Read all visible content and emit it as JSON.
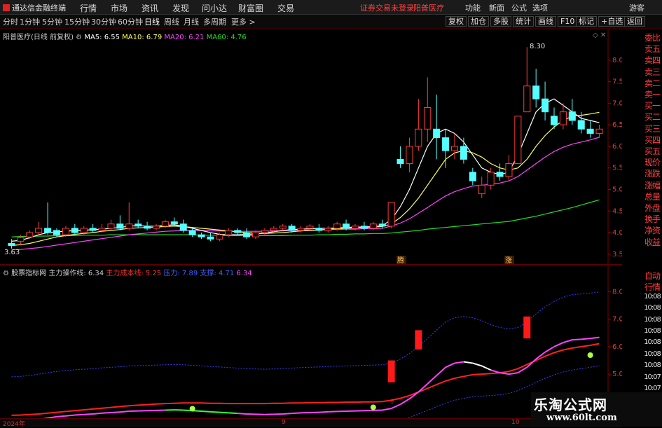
{
  "menu": {
    "app_title": "通达信金融终端",
    "items": [
      "行情",
      "市场",
      "资讯",
      "发现",
      "问小达",
      "财富圈",
      "交易"
    ],
    "login_text": "证券交易未登录",
    "stock_name": "阳普医疗",
    "right_items": [
      "功能",
      "新面",
      "公式",
      "选项"
    ],
    "guest": "游客"
  },
  "periods": [
    "分时",
    "1分钟",
    "5分钟",
    "15分钟",
    "30分钟",
    "60分钟",
    "日线",
    "周线",
    "月线",
    "多周期",
    "更多 >"
  ],
  "active_period": "日线",
  "toolbar_right": [
    "复权",
    "加仓",
    "多股",
    "统计",
    "画线",
    "F10",
    "标记",
    "+自选",
    "返回"
  ],
  "main": {
    "legend_title": "阳普医疗(日线 前复权)",
    "ma5": "MA5: 6.55",
    "ma10": "MA10: 6.79",
    "ma20": "MA20: 6.21",
    "ma60": "MA60: 4.76",
    "high_label": "8.30",
    "low_label": "3.63",
    "yticks": [
      "8.00",
      "7.50",
      "7.00",
      "6.50",
      "6.00",
      "5.50",
      "5.00",
      "4.50",
      "4.00",
      "3.50"
    ],
    "marker1": "腾",
    "marker2": "涨"
  },
  "sub": {
    "legend_title": "股票指标网",
    "zl_label": "主力操作线: 6.34",
    "cost_label": "主力成本线: 5.25",
    "a_label": "压力: 7.89",
    "b_label": "支撑: 4.71",
    "c_label": "6.34",
    "yticks": [
      "8.00",
      "7.00",
      "6.00",
      "5.00"
    ]
  },
  "right_panel": [
    "委比",
    "卖五",
    "卖四",
    "卖三",
    "卖二",
    "卖一",
    "买一",
    "买二",
    "买三",
    "买四",
    "买五",
    "现价",
    "涨跌",
    "涨幅",
    "总量",
    "外盘",
    "换手",
    "净资",
    "收益"
  ],
  "right_panel2": [
    "自动",
    "行情",
    "10:08",
    "10:08",
    "10:08",
    "10:08",
    "10:08",
    "10:08",
    "10:08",
    "10:07",
    "10:07",
    "10:07",
    "10:07",
    "10:07"
  ],
  "footer": {
    "year": "2024年",
    "m9": "9",
    "m10": "10"
  },
  "watermark": {
    "line1": "乐淘公式网",
    "line2": "www.60lt.com"
  },
  "colors": {
    "up": "#ff3b3b",
    "down": "#54ffff",
    "ma5": "#ffffff",
    "ma10": "#ffff55",
    "ma20": "#ff44ff",
    "ma60": "#22dd22"
  },
  "chart_data": {
    "type": "candlestick",
    "title": "阳普医疗(日线 前复权)",
    "ylim": [
      3.4,
      8.5
    ],
    "candles": [
      [
        3.75,
        3.85,
        3.7,
        3.63
      ],
      [
        3.8,
        3.95,
        3.88,
        3.7
      ],
      [
        3.9,
        4.05,
        4.0,
        3.85
      ],
      [
        4.0,
        4.25,
        4.1,
        3.95
      ],
      [
        4.1,
        4.7,
        4.0,
        3.95
      ],
      [
        4.05,
        4.1,
        3.95,
        3.9
      ],
      [
        3.95,
        4.15,
        4.1,
        3.9
      ],
      [
        4.1,
        4.2,
        4.0,
        3.95
      ],
      [
        4.0,
        4.15,
        4.1,
        3.95
      ],
      [
        4.1,
        4.2,
        4.05,
        4.0
      ],
      [
        4.05,
        4.2,
        4.1,
        4.0
      ],
      [
        4.1,
        4.3,
        4.2,
        4.05
      ],
      [
        4.2,
        4.4,
        4.1,
        4.05
      ],
      [
        4.1,
        4.7,
        4.2,
        4.05
      ],
      [
        4.2,
        4.3,
        4.15,
        4.1
      ],
      [
        4.15,
        4.25,
        4.1,
        4.05
      ],
      [
        4.1,
        4.2,
        4.15,
        4.05
      ],
      [
        4.15,
        4.3,
        4.25,
        4.1
      ],
      [
        4.25,
        4.35,
        4.2,
        4.15
      ],
      [
        4.2,
        4.3,
        4.05,
        4.0
      ],
      [
        4.05,
        4.1,
        3.95,
        3.9
      ],
      [
        3.95,
        4.0,
        3.9,
        3.85
      ],
      [
        3.9,
        4.0,
        3.85,
        3.8
      ],
      [
        3.85,
        4.0,
        3.95,
        3.8
      ],
      [
        3.95,
        4.1,
        4.05,
        3.9
      ],
      [
        4.05,
        4.1,
        4.0,
        3.95
      ],
      [
        4.0,
        4.1,
        3.9,
        3.85
      ],
      [
        3.9,
        4.05,
        4.0,
        3.85
      ],
      [
        4.0,
        4.1,
        4.05,
        3.95
      ],
      [
        4.05,
        4.15,
        4.1,
        4.0
      ],
      [
        4.1,
        4.2,
        4.15,
        4.05
      ],
      [
        4.15,
        4.2,
        4.05,
        4.0
      ],
      [
        4.05,
        4.15,
        4.1,
        4.0
      ],
      [
        4.1,
        4.2,
        4.15,
        4.05
      ],
      [
        4.1,
        4.2,
        4.05,
        4.0
      ],
      [
        4.05,
        4.15,
        4.1,
        4.0
      ],
      [
        4.1,
        4.25,
        4.2,
        4.05
      ],
      [
        4.2,
        4.3,
        4.1,
        4.05
      ],
      [
        4.1,
        4.2,
        4.15,
        4.05
      ],
      [
        4.15,
        4.25,
        4.1,
        4.05
      ],
      [
        4.1,
        4.25,
        4.2,
        4.05
      ],
      [
        4.2,
        4.3,
        4.15,
        4.1
      ],
      [
        4.15,
        4.7,
        4.7,
        4.1
      ],
      [
        5.7,
        6.0,
        5.6,
        5.5
      ],
      [
        5.6,
        6.2,
        6.0,
        5.4
      ],
      [
        6.0,
        7.1,
        6.4,
        5.9
      ],
      [
        6.4,
        7.6,
        6.9,
        6.1
      ],
      [
        6.4,
        7.2,
        6.2,
        5.7
      ],
      [
        6.2,
        6.4,
        5.9,
        5.5
      ],
      [
        5.9,
        6.3,
        6.0,
        5.7
      ],
      [
        6.0,
        6.2,
        5.7,
        5.6
      ],
      [
        5.4,
        5.5,
        5.2,
        5.1
      ],
      [
        4.9,
        5.3,
        5.1,
        4.8
      ],
      [
        5.1,
        5.5,
        5.4,
        5.0
      ],
      [
        5.4,
        5.6,
        5.3,
        5.2
      ],
      [
        5.3,
        5.8,
        5.6,
        5.2
      ],
      [
        5.6,
        6.7,
        6.7,
        5.6
      ],
      [
        6.8,
        8.3,
        7.4,
        6.8
      ],
      [
        7.4,
        7.8,
        7.1,
        6.9
      ],
      [
        7.1,
        7.5,
        6.8,
        6.6
      ],
      [
        6.7,
        6.9,
        6.5,
        6.4
      ],
      [
        6.5,
        7.0,
        6.8,
        6.4
      ],
      [
        6.8,
        7.1,
        6.6,
        6.5
      ],
      [
        6.6,
        6.8,
        6.4,
        6.3
      ],
      [
        6.4,
        6.6,
        6.3,
        6.2
      ],
      [
        6.3,
        6.5,
        6.4,
        6.2
      ]
    ],
    "ma5": [
      3.8,
      3.82,
      3.88,
      3.95,
      4.0,
      4.02,
      4.03,
      4.05,
      4.05,
      4.07,
      4.08,
      4.1,
      4.12,
      4.15,
      4.16,
      4.15,
      4.15,
      4.17,
      4.18,
      4.15,
      4.1,
      4.05,
      4.0,
      3.96,
      3.95,
      3.95,
      3.96,
      3.97,
      3.99,
      4.02,
      4.05,
      4.07,
      4.08,
      4.09,
      4.1,
      4.1,
      4.11,
      4.12,
      4.13,
      4.13,
      4.14,
      4.16,
      4.3,
      4.6,
      5.0,
      5.5,
      6.0,
      6.3,
      6.4,
      6.3,
      6.1,
      5.8,
      5.5,
      5.4,
      5.35,
      5.4,
      5.8,
      6.3,
      6.8,
      7.0,
      7.1,
      6.95,
      6.8,
      6.65,
      6.6,
      6.55
    ],
    "ma10": [
      3.7,
      3.72,
      3.75,
      3.8,
      3.85,
      3.9,
      3.93,
      3.96,
      3.98,
      4.0,
      4.03,
      4.05,
      4.07,
      4.1,
      4.11,
      4.12,
      4.13,
      4.14,
      4.15,
      4.14,
      4.12,
      4.1,
      4.08,
      4.06,
      4.04,
      4.02,
      4.0,
      3.99,
      3.98,
      3.99,
      4.0,
      4.02,
      4.04,
      4.05,
      4.06,
      4.08,
      4.09,
      4.1,
      4.11,
      4.12,
      4.13,
      4.14,
      4.2,
      4.35,
      4.55,
      4.8,
      5.1,
      5.4,
      5.7,
      5.85,
      5.9,
      5.85,
      5.75,
      5.6,
      5.5,
      5.45,
      5.5,
      5.7,
      6.0,
      6.25,
      6.45,
      6.6,
      6.7,
      6.72,
      6.75,
      6.79
    ],
    "ma20": [
      3.6,
      3.61,
      3.63,
      3.65,
      3.68,
      3.71,
      3.74,
      3.77,
      3.8,
      3.83,
      3.86,
      3.89,
      3.92,
      3.95,
      3.97,
      3.99,
      4.01,
      4.03,
      4.04,
      4.05,
      4.05,
      4.05,
      4.04,
      4.04,
      4.03,
      4.03,
      4.03,
      4.03,
      4.03,
      4.04,
      4.04,
      4.05,
      4.05,
      4.06,
      4.06,
      4.07,
      4.07,
      4.08,
      4.08,
      4.09,
      4.09,
      4.1,
      4.15,
      4.22,
      4.32,
      4.45,
      4.58,
      4.72,
      4.85,
      4.95,
      5.02,
      5.08,
      5.1,
      5.12,
      5.15,
      5.2,
      5.3,
      5.45,
      5.6,
      5.75,
      5.88,
      5.98,
      6.05,
      6.1,
      6.15,
      6.21
    ],
    "ma60": [
      3.9,
      3.91,
      3.91,
      3.92,
      3.92,
      3.93,
      3.93,
      3.93,
      3.94,
      3.94,
      3.94,
      3.95,
      3.95,
      3.95,
      3.95,
      3.95,
      3.95,
      3.95,
      3.95,
      3.95,
      3.95,
      3.94,
      3.94,
      3.94,
      3.93,
      3.93,
      3.93,
      3.93,
      3.93,
      3.93,
      3.93,
      3.94,
      3.94,
      3.94,
      3.95,
      3.95,
      3.96,
      3.96,
      3.97,
      3.97,
      3.98,
      3.98,
      3.99,
      4.01,
      4.03,
      4.05,
      4.08,
      4.1,
      4.12,
      4.14,
      4.16,
      4.18,
      4.2,
      4.22,
      4.24,
      4.26,
      4.3,
      4.34,
      4.38,
      4.43,
      4.48,
      4.53,
      4.58,
      4.64,
      4.7,
      4.76
    ]
  }
}
